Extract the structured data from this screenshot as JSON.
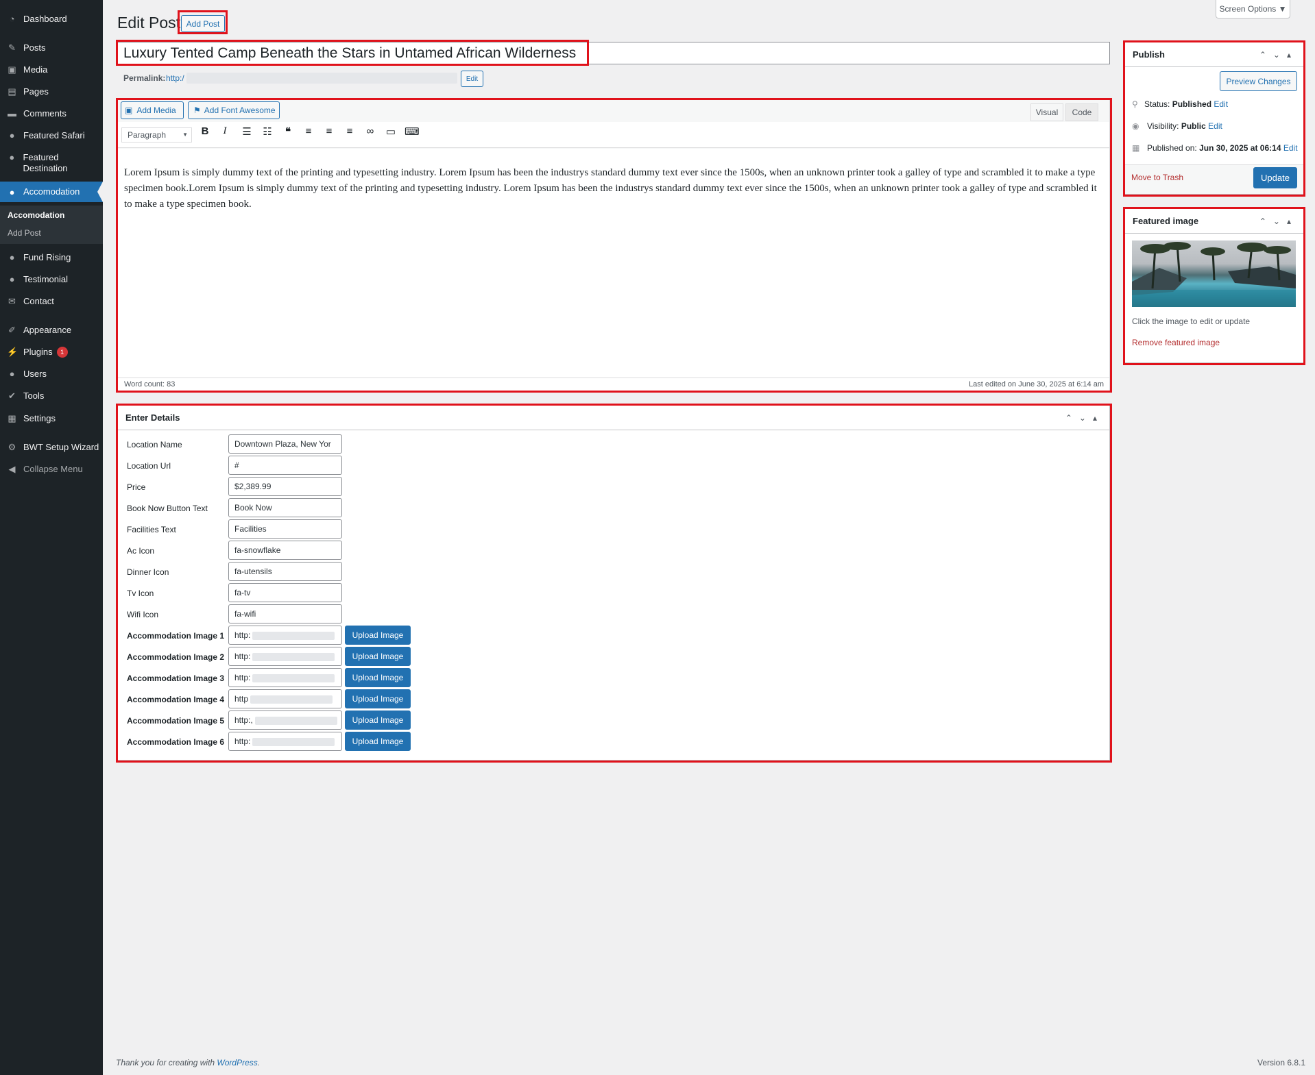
{
  "sidebar": {
    "items": [
      {
        "label": "Dashboard",
        "icon": "dashboard-icon"
      },
      {
        "label": "Posts",
        "icon": "pin-icon"
      },
      {
        "label": "Media",
        "icon": "media-icon"
      },
      {
        "label": "Pages",
        "icon": "page-icon"
      },
      {
        "label": "Comments",
        "icon": "comment-icon"
      },
      {
        "label": "Featured Safari",
        "icon": "user-group-icon"
      },
      {
        "label": "Featured Destination",
        "icon": "user-group-icon"
      },
      {
        "label": "Accomodation",
        "icon": "user-group-icon"
      },
      {
        "label": "Fund Rising",
        "icon": "user-group-icon"
      },
      {
        "label": "Testimonial",
        "icon": "user-group-icon"
      },
      {
        "label": "Contact",
        "icon": "mail-icon"
      },
      {
        "label": "Appearance",
        "icon": "brush-icon"
      },
      {
        "label": "Plugins",
        "icon": "plugin-icon"
      },
      {
        "label": "Users",
        "icon": "user-icon"
      },
      {
        "label": "Tools",
        "icon": "wrench-icon"
      },
      {
        "label": "Settings",
        "icon": "settings-icon"
      },
      {
        "label": "BWT Setup Wizard",
        "icon": "gear-icon"
      },
      {
        "label": "Collapse Menu",
        "icon": "collapse-icon"
      }
    ],
    "submenu": {
      "current": "Accomodation",
      "add": "Add Post"
    },
    "plugins_badge": "1"
  },
  "header": {
    "title": "Edit Post",
    "add_post": "Add Post",
    "screen_options": "Screen Options ▼"
  },
  "post": {
    "title": "Luxury Tented Camp Beneath the Stars in Untamed African Wilderness",
    "permalink_label": "Permalink:",
    "permalink_url": "http:/",
    "permalink_edit": "Edit"
  },
  "editor": {
    "add_media": "Add Media",
    "add_font_awesome": "Add Font Awesome",
    "tab_visual": "Visual",
    "tab_code": "Code",
    "format": "Paragraph",
    "content": "Lorem Ipsum is simply dummy text of the printing and typesetting industry. Lorem Ipsum has been the industrys standard dummy text ever since the 1500s, when an unknown printer took a galley of type and scrambled it to make a type specimen book.Lorem Ipsum is simply dummy text of the printing and typesetting industry. Lorem Ipsum has been the industrys standard dummy text ever since the 1500s, when an unknown printer took a galley of type and scrambled it to make a type specimen book.",
    "word_count": "Word count: 83",
    "last_edited": "Last edited on June 30, 2025 at 6:14 am"
  },
  "details": {
    "title": "Enter Details",
    "fields": [
      {
        "label": "Location Name",
        "value": "Downtown Plaza, New Yor"
      },
      {
        "label": "Location Url",
        "value": "#"
      },
      {
        "label": "Price",
        "value": "$2,389.99"
      },
      {
        "label": "Book Now Button Text",
        "value": "Book Now"
      },
      {
        "label": "Facilities Text",
        "value": "Facilities"
      },
      {
        "label": "Ac Icon",
        "value": "fa-snowflake"
      },
      {
        "label": "Dinner Icon",
        "value": "fa-utensils"
      },
      {
        "label": "Tv Icon",
        "value": "fa-tv"
      },
      {
        "label": "Wifi Icon",
        "value": "fa-wifi"
      }
    ],
    "images": [
      {
        "label": "Accommodation Image 1",
        "value": "http:"
      },
      {
        "label": "Accommodation Image 2",
        "value": "http:"
      },
      {
        "label": "Accommodation Image 3",
        "value": "http:"
      },
      {
        "label": "Accommodation Image 4",
        "value": "http"
      },
      {
        "label": "Accommodation Image 5",
        "value": "http:,"
      },
      {
        "label": "Accommodation Image 6",
        "value": "http:"
      }
    ],
    "upload_label": "Upload Image"
  },
  "publish": {
    "title": "Publish",
    "preview": "Preview Changes",
    "status_label": "Status:",
    "status_value": "Published",
    "visibility_label": "Visibility:",
    "visibility_value": "Public",
    "published_label": "Published on:",
    "published_value": "Jun 30, 2025 at 06:14",
    "edit": "Edit",
    "trash": "Move to Trash",
    "update": "Update"
  },
  "featured": {
    "title": "Featured image",
    "hint": "Click the image to edit or update",
    "remove": "Remove featured image"
  },
  "footer": {
    "thanks": "Thank you for creating with",
    "wp": "WordPress",
    "version": "Version 6.8.1"
  },
  "colors": {
    "accent": "#2271b1",
    "sidebar": "#1d2327",
    "highlight": "#e0121b"
  }
}
